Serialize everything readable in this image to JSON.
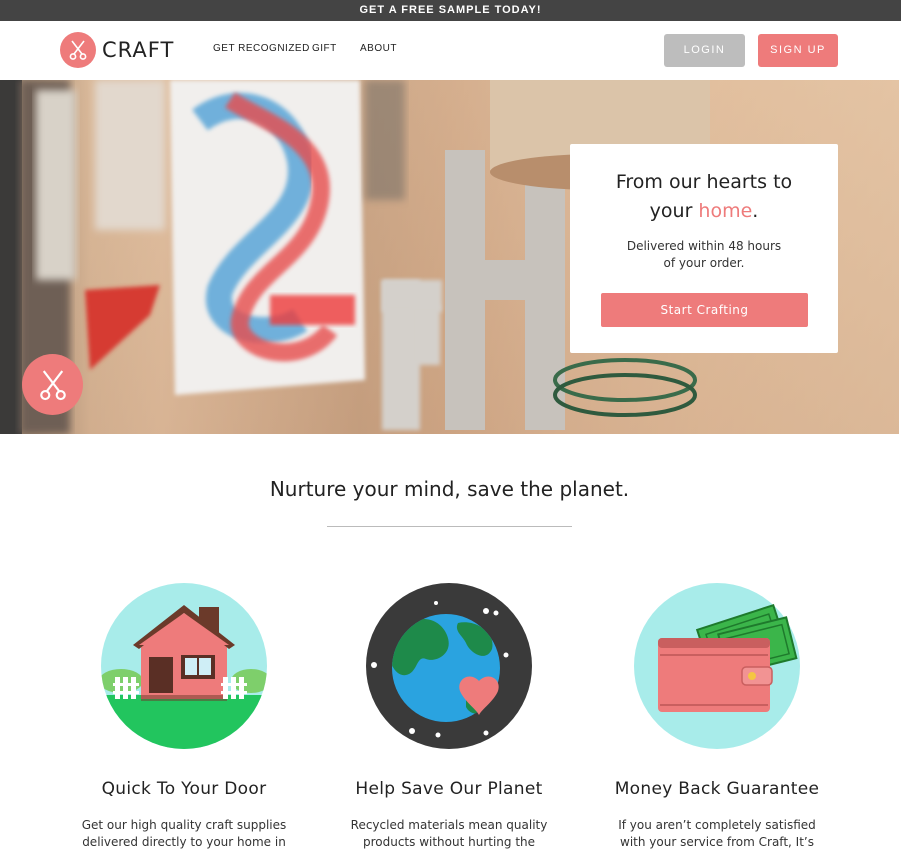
{
  "promo": {
    "text": "GET A FREE SAMPLE TODAY!"
  },
  "brand": {
    "name": "CRAFT",
    "logo_icon": "scissors-icon",
    "accent": "#ee7b7b"
  },
  "nav": {
    "items": [
      "GET RECOGNIZED",
      "GIFT",
      "ABOUT"
    ]
  },
  "auth": {
    "login_label": "LOGIN",
    "signup_label": "SIGN UP"
  },
  "hero": {
    "title_line1": "From our hearts to",
    "title_pre": "your ",
    "title_accent": "home",
    "title_post": ".",
    "subtitle_line1": "Delivered within 48 hours",
    "subtitle_line2": "of your order.",
    "cta_label": "Start Crafting",
    "badge_icon": "scissors-icon"
  },
  "section": {
    "title": "Nurture your mind, save the planet."
  },
  "features": [
    {
      "icon": "house-icon",
      "title": "Quick To Your Door",
      "line1": "Get our high quality craft supplies",
      "line2": "delivered directly to your home in"
    },
    {
      "icon": "earth-icon",
      "title": "Help Save Our Planet",
      "line1": "Recycled materials mean quality",
      "line2": "products without hurting the"
    },
    {
      "icon": "wallet-icon",
      "title": "Money Back Guarantee",
      "line1": "If you aren’t completely satisfied",
      "line2": "with your service from Craft, It’s"
    }
  ]
}
